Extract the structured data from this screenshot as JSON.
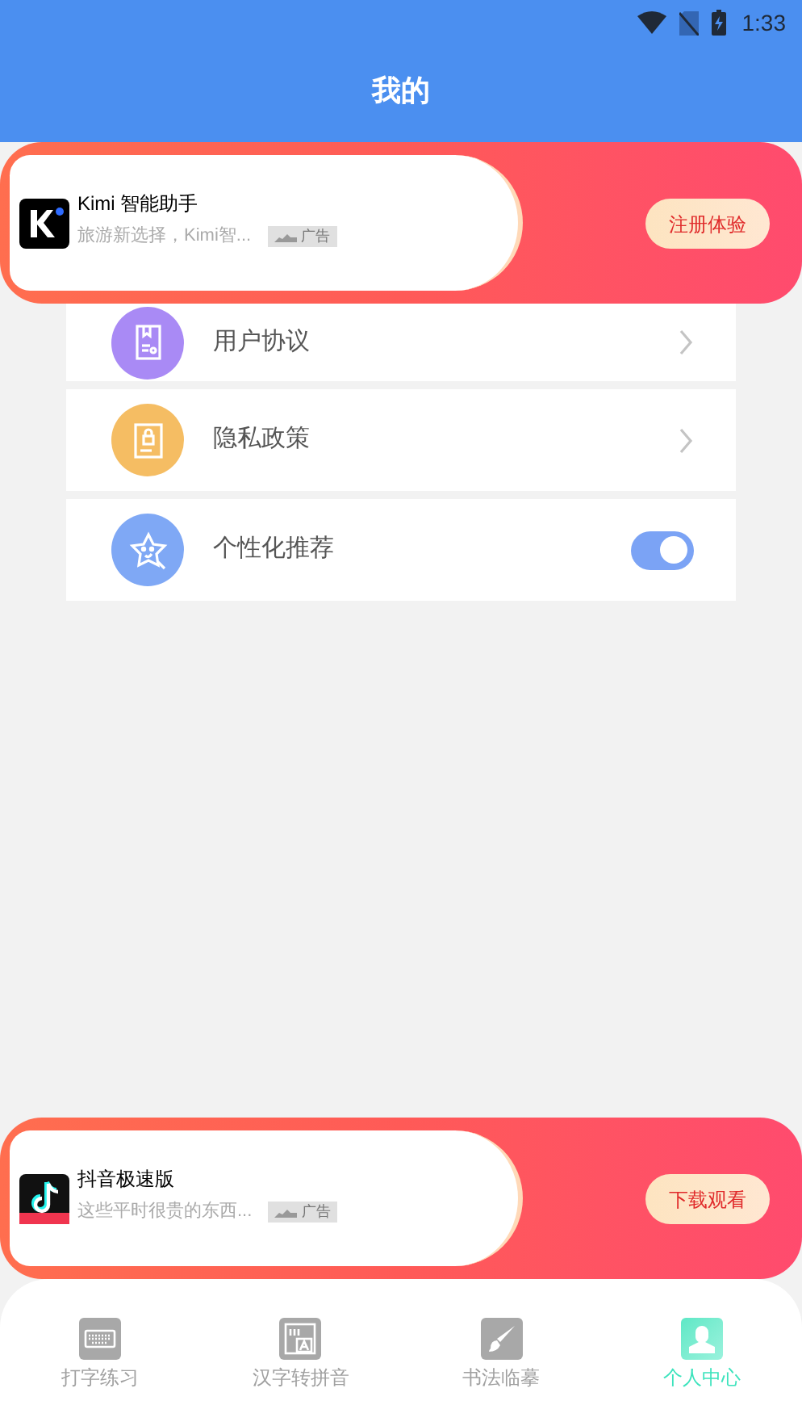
{
  "status_bar": {
    "time": "1:33"
  },
  "header": {
    "title": "我的"
  },
  "ads": [
    {
      "kind": "kimi",
      "name": "Kimi 智能助手",
      "desc": "旅游新选择，Kimi智...",
      "tag": "广告",
      "action": "注册体验"
    },
    {
      "kind": "douyin",
      "name": "抖音极速版",
      "desc": "这些平时很贵的东西...",
      "tag": "广告",
      "action": "下载观看"
    }
  ],
  "menu": [
    {
      "kind": "link",
      "label": "用户协议"
    },
    {
      "kind": "link",
      "label": "隐私政策"
    },
    {
      "kind": "toggle",
      "label": "个性化推荐",
      "on": true
    }
  ],
  "tabs": [
    {
      "label": "打字练习",
      "selected": false
    },
    {
      "label": "汉字转拼音",
      "selected": false
    },
    {
      "label": "书法临摹",
      "selected": false
    },
    {
      "label": "个人中心",
      "selected": true
    }
  ]
}
